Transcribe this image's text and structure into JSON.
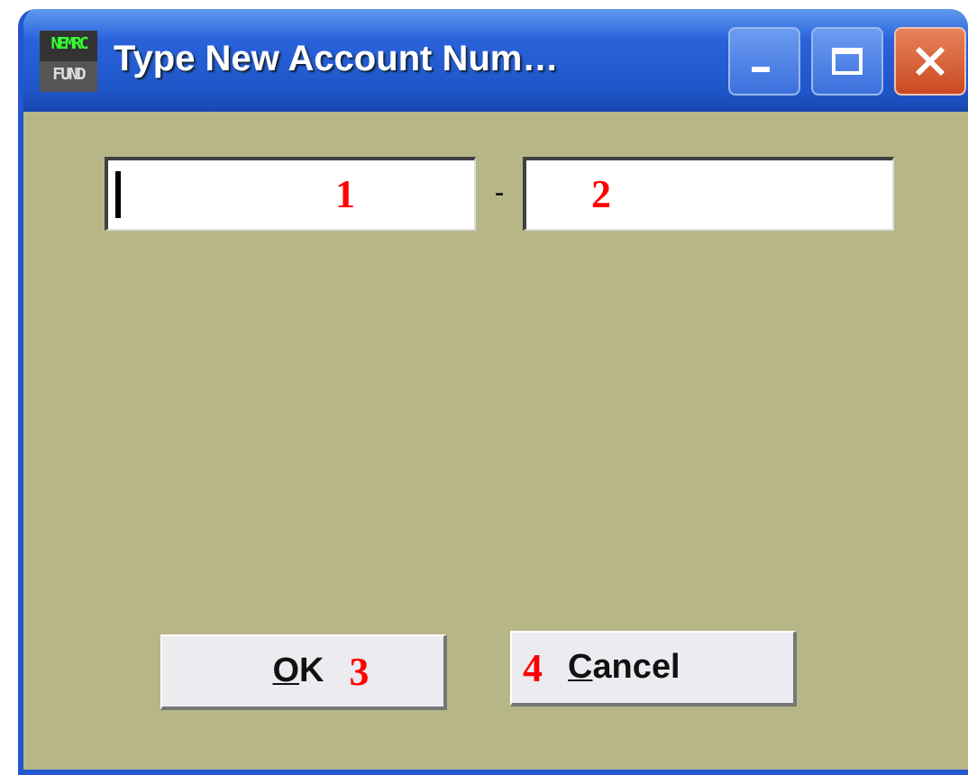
{
  "window": {
    "title": "Type New Account Num…",
    "logo": {
      "top": "NEMRC",
      "bottom": "FUND"
    }
  },
  "fields": [
    {
      "focused": true,
      "marker": "1"
    },
    {
      "focused": false,
      "marker": "2"
    }
  ],
  "separator": "-",
  "buttons": [
    {
      "label": "OK",
      "marker": "3",
      "kind": "trailing"
    },
    {
      "label": "Cancel",
      "marker": "4",
      "kind": "leading"
    }
  ]
}
